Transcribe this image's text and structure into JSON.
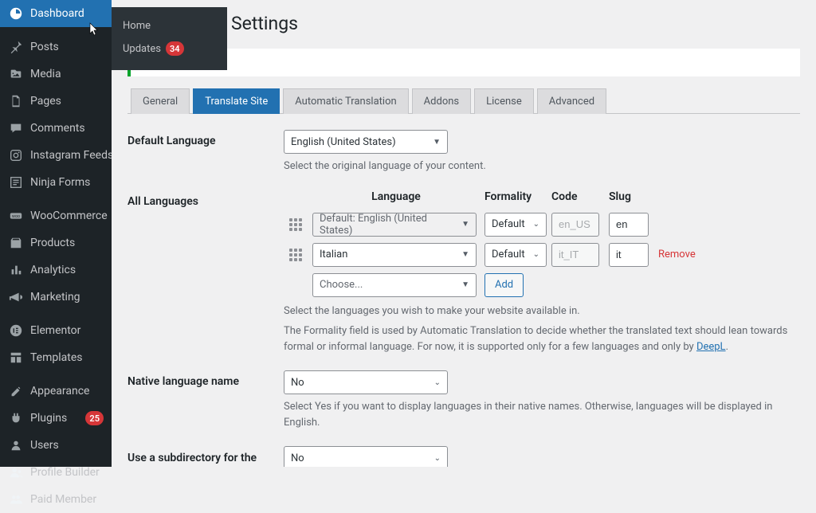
{
  "sidebar": {
    "items": [
      {
        "name": "dashboard",
        "label": "Dashboard",
        "current": true,
        "icon": "dashboard"
      },
      {
        "name": "posts",
        "label": "Posts",
        "icon": "pin",
        "sep": true
      },
      {
        "name": "media",
        "label": "Media",
        "icon": "media"
      },
      {
        "name": "pages",
        "label": "Pages",
        "icon": "page"
      },
      {
        "name": "comments",
        "label": "Comments",
        "icon": "comment"
      },
      {
        "name": "instagram-feeds",
        "label": "Instagram Feeds",
        "icon": "instagram"
      },
      {
        "name": "ninja-forms",
        "label": "Ninja Forms",
        "icon": "form"
      },
      {
        "name": "woocommerce",
        "label": "WooCommerce",
        "icon": "woo",
        "sep": true
      },
      {
        "name": "products",
        "label": "Products",
        "icon": "products"
      },
      {
        "name": "analytics",
        "label": "Analytics",
        "icon": "analytics"
      },
      {
        "name": "marketing",
        "label": "Marketing",
        "icon": "marketing"
      },
      {
        "name": "elementor",
        "label": "Elementor",
        "icon": "elementor",
        "sep": true
      },
      {
        "name": "templates",
        "label": "Templates",
        "icon": "templates"
      },
      {
        "name": "appearance",
        "label": "Appearance",
        "icon": "appearance",
        "sep": true
      },
      {
        "name": "plugins",
        "label": "Plugins",
        "icon": "plugin",
        "badge": "25"
      },
      {
        "name": "users",
        "label": "Users",
        "icon": "user"
      },
      {
        "name": "profile-builder",
        "label": "Profile Builder",
        "icon": "profile"
      },
      {
        "name": "paid-member",
        "label": "Paid Member",
        "icon": "paidmember"
      }
    ],
    "flyout": {
      "home_label": "Home",
      "updates_label": "Updates",
      "updates_badge": "34"
    }
  },
  "page": {
    "title": "Settings",
    "tabs": [
      "General",
      "Translate Site",
      "Automatic Translation",
      "Addons",
      "License",
      "Advanced"
    ],
    "active_tab": 1
  },
  "fields": {
    "default_language": {
      "label": "Default Language",
      "value": "English (United States)",
      "help": "Select the original language of your content."
    },
    "all_languages": {
      "label": "All Languages",
      "headers": {
        "language": "Language",
        "formality": "Formality",
        "code": "Code",
        "slug": "Slug"
      },
      "rows": [
        {
          "language": "Default: English (United States)",
          "formality": "Default",
          "code": "en_US",
          "slug": "en",
          "is_default": true
        },
        {
          "language": "Italian",
          "formality": "Default",
          "code": "it_IT",
          "slug": "it",
          "is_default": false
        }
      ],
      "choose_placeholder": "Choose...",
      "add_label": "Add",
      "remove_label": "Remove",
      "help1": "Select the languages you wish to make your website available in.",
      "help2": "The Formality field is used by Automatic Translation to decide whether the translated text should lean towards formal or informal language. For now, it is supported only for a few languages and only by ",
      "help2_link": "DeepL",
      "help2_tail": "."
    },
    "native_language_name": {
      "label": "Native language name",
      "value": "No",
      "help": "Select Yes if you want to display languages in their native names. Otherwise, languages will be displayed in English."
    },
    "subdirectory": {
      "label": "Use a subdirectory for the default language",
      "value": "No"
    }
  }
}
